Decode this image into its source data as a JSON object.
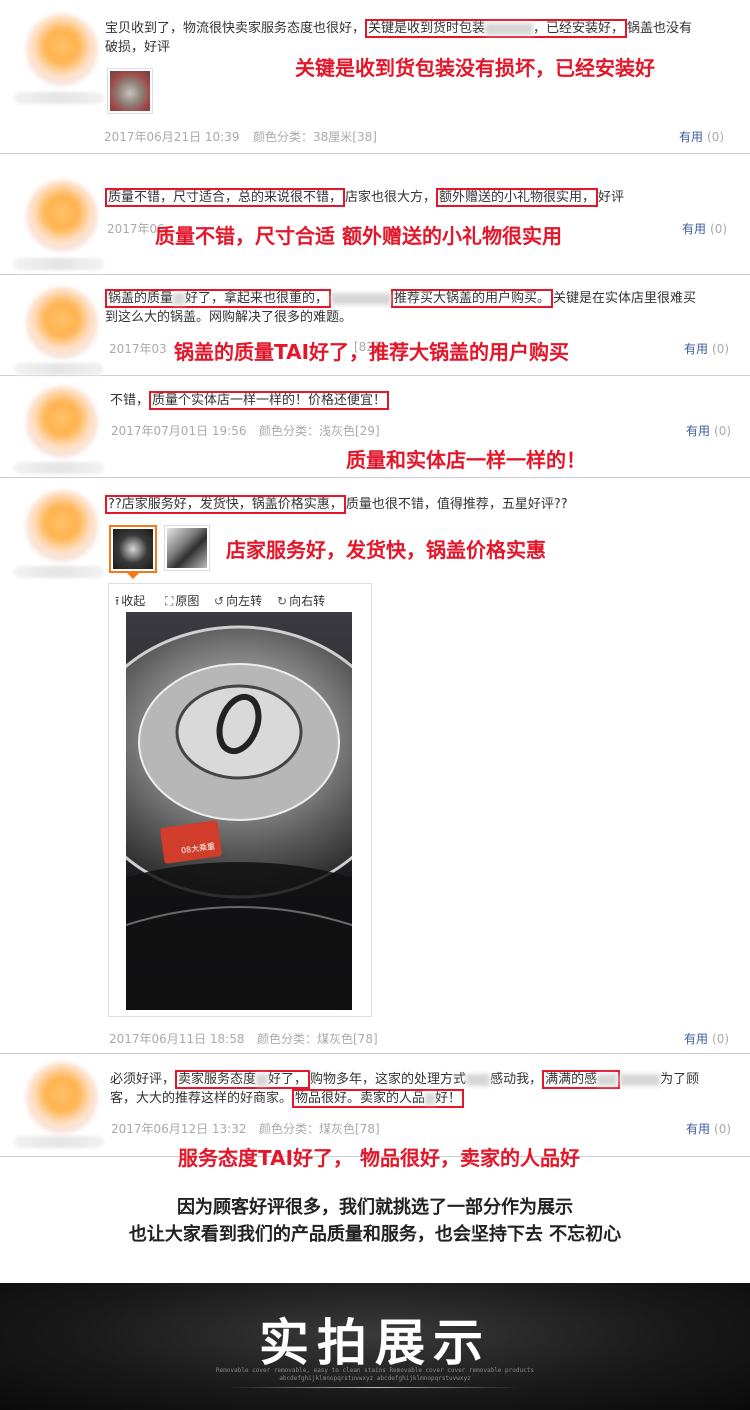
{
  "reviews": [
    {
      "text_pre": "宝贝收到了，物流很快卖家服务态度也很好，",
      "hl1": "关键是收到货时包装",
      "hl1b": "，已经安装好，",
      "text_post": "锅盖也没有",
      "line2": "破损，好评",
      "date": "2017年06月21日 10:39",
      "variant": "颜色分类：38厘米[38]",
      "callout": "关键是收到货包装没有损坏，已经安装好"
    },
    {
      "hl1": "质量不错，尺寸适合，总的来说很不错，",
      "mid": "店家也很大方，",
      "hl2": "额外赠送的小礼物很实用，",
      "post": "好评",
      "date_partial": "2017年06",
      "callout": "质量不错，尺寸合适 额外赠送的小礼物很实用"
    },
    {
      "hl1": "锅盖的质量",
      "hl1b": "好了，拿起来也很重的，",
      "hl2": "推荐买大锅盖的用户购买。",
      "post": "关键是在实体店里很难买",
      "line2": "到这么大的锅盖。网购解决了很多的难题。",
      "date_partial": "2017年03",
      "variant_partial": "[82]",
      "callout": "锅盖的质量TAI好了，推荐大锅盖的用户购买"
    },
    {
      "pre": "不错，",
      "hl1": "质量个实体店一样一样的！价格还便宜！",
      "date": "2017年07月01日 19:56",
      "variant": "颜色分类：浅灰色[29]",
      "callout": "质量和实体店一样一样的！"
    },
    {
      "hl1": "??店家服务好，发货快，锅盖价格实惠，",
      "post": "质量也很不错，值得推荐，五星好评??",
      "date": "2017年06月11日 18:58",
      "variant": "颜色分类：煤灰色[78]",
      "callout": "店家服务好，发货快，锅盖价格实惠",
      "viewer": {
        "collapse": "收起",
        "original": "原图",
        "rotate_left": "向左转",
        "rotate_right": "向右转"
      },
      "sticker_text": "08大乘重"
    },
    {
      "pre": "必须好评，",
      "hl1": "卖家服务态度",
      "hl1b": "好了，",
      "mid": "购物多年，这家的处理方式",
      "mid2": "感动我，",
      "hl2": "满满的感",
      "post": "为了顾",
      "line2_pre": "客，大大的推荐这样的好商家。",
      "hl3": "物品很好。卖家的人品",
      "hl3b": "好！",
      "date": "2017年06月12日 13:32",
      "variant": "颜色分类：煤灰色[78]",
      "callout": "服务态度TAI好了， 物品很好，卖家的人品好"
    }
  ],
  "useful_label": "有用",
  "useful_count": "(0)",
  "footer": {
    "line1": "因为顾客好评很多，我们就挑选了一部分作为展示",
    "line2": "也让大家看到我们的产品质量和服务，也会坚持下去 不忘初心"
  },
  "banner": {
    "title": "实拍展示",
    "sub1": "Removable cover removable, easy to clean stains Removable cover cover removable products",
    "sub2": "abcdefghijklmnopqrstuvwxyz abcdefghijklmnopqrstuvwxyz"
  }
}
